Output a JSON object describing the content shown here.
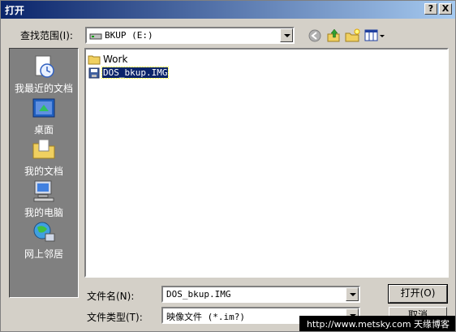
{
  "window": {
    "title": "打开",
    "help_label": "?",
    "close_label": "X"
  },
  "lookin": {
    "label": "查找范围(I):",
    "value": "BKUP (E:)"
  },
  "places": [
    {
      "label": "我最近的文档",
      "icon": "recent-documents-icon"
    },
    {
      "label": "桌面",
      "icon": "desktop-icon"
    },
    {
      "label": "我的文档",
      "icon": "my-documents-icon"
    },
    {
      "label": "我的电脑",
      "icon": "my-computer-icon"
    },
    {
      "label": "网上邻居",
      "icon": "network-places-icon"
    }
  ],
  "files": [
    {
      "name": "Work",
      "type": "folder"
    },
    {
      "name": "DOS_bkup.IMG",
      "type": "image-file",
      "selected": true
    }
  ],
  "filename": {
    "label": "文件名(N):",
    "value": "DOS_bkup.IMG"
  },
  "filetype": {
    "label": "文件类型(T):",
    "value": "映像文件 (*.im?)"
  },
  "buttons": {
    "open": "打开(O)",
    "cancel": "取消"
  },
  "watermark": "http://www.metsky.com 天缘博客",
  "colors": {
    "title_start": "#0a246a",
    "title_end": "#a6caf0",
    "dialog_bg": "#d4d0c8",
    "places_bg": "#808080",
    "selection": "#0a246a"
  }
}
